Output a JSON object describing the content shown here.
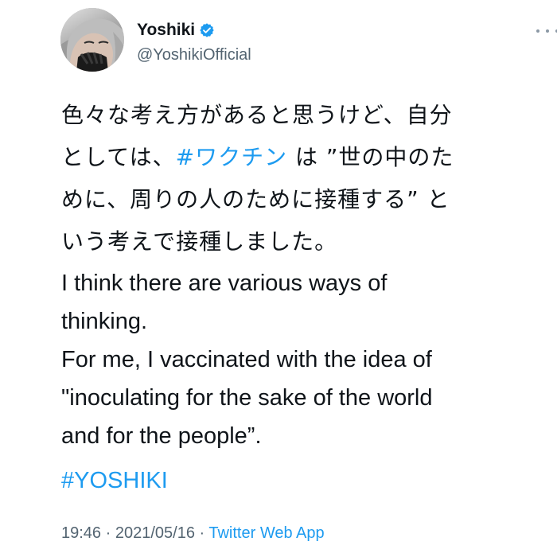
{
  "user": {
    "display_name": "Yoshiki",
    "handle": "@YoshikiOfficial",
    "verified_icon": "verified-badge-icon",
    "avatar_icon": "avatar"
  },
  "header": {
    "more_icon": "more-options-icon"
  },
  "tweet": {
    "jp_lines": [
      {
        "text": "色々な考え方があると思うけど、自分"
      },
      {
        "prefix": "としては、",
        "hashtag": "#ワクチン",
        "suffix": " は ”世の中のた"
      },
      {
        "text": "めに、周りの人のために接種する” と"
      },
      {
        "text": "いう考えで接種しました。"
      }
    ],
    "en_lines": [
      "I think there are various ways of",
      "thinking.",
      "For me, I vaccinated with the idea of",
      "\"inoculating for the sake of the world",
      "and for the people”."
    ],
    "hashtag_yoshiki": "#YOSHIKI"
  },
  "meta": {
    "time": "19:46",
    "separator1": " · ",
    "date": "2021/05/16",
    "separator2": " · ",
    "source": "Twitter Web App"
  },
  "colors": {
    "link": "#1d9bf0",
    "text": "#0f1419",
    "muted": "#536471"
  }
}
